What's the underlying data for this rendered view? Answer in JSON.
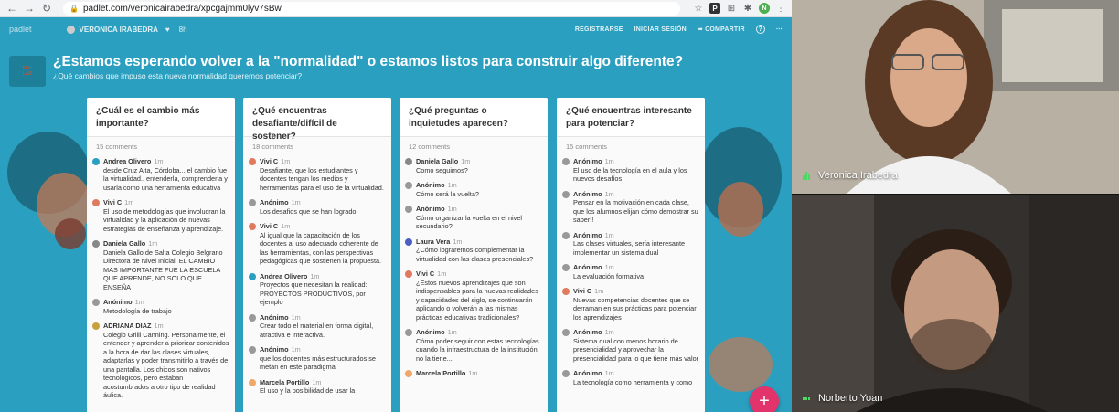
{
  "browser": {
    "url": "padlet.com/veronicairabedra/xpcgajmm0lyv7sBw",
    "avatar_initial": "N"
  },
  "padlet": {
    "brand": "padlet",
    "author": "VERONICA IRABEDRA",
    "time": "8h",
    "actions": {
      "register": "REGISTRARSE",
      "login": "INICIAR SESIÓN",
      "share": "COMPARTIR"
    },
    "title": "¿Estamos esperando volver a la \"normalidad\" o estamos listos para construir algo diferente?",
    "subtitle": "¿Qué cambios que impuso esta nueva normalidad queremos potenciar?",
    "accent": "#2b9fbf",
    "columns": [
      {
        "title": "¿Cuál es el cambio más importante?",
        "count": "15 comments",
        "posts": [
          {
            "who": "Andrea Olivero",
            "when": "1m",
            "text": "desde Cruz Alta, Córdoba... el cambio fue la virtualidad.. entenderla, comprenderla y usarla como una herramienta educativa",
            "color": "#2b9fbf"
          },
          {
            "who": "Vivi C",
            "when": "1m",
            "text": "El uso de metodologías que involucran la virtualidad y la aplicación de nuevas estrategias de enseñanza y aprendizaje.",
            "color": "#e07a5f"
          },
          {
            "who": "Daniela Gallo",
            "when": "1m",
            "text": "Daniela Gallo de Salta Colegio Belgrano Directora de Nivel Inicial. EL CAMBIO MAS IMPORTANTE FUE LA ESCUELA QUE APRENDE, NO SOLO QUE ENSEÑA",
            "color": "#888"
          },
          {
            "who": "Anónimo",
            "when": "1m",
            "text": "Metodología de trabajo",
            "color": "#999"
          },
          {
            "who": "ADRIANA DIAZ",
            "when": "1m",
            "text": "Colegio Grilli Canning. Personalmente, el entender y aprender a priorizar contenidos a la hora de dar las clases virtuales, adaptarlas y poder transmitirlo a través de una pantalla. Los chicos son nativos tecnológicos, pero estaban acostumbrados a otro tipo de realidad áulica.",
            "color": "#c8a03c"
          }
        ]
      },
      {
        "title": "¿Qué encuentras desafiante/difícil de sostener?",
        "count": "18 comments",
        "posts": [
          {
            "who": "Vivi C",
            "when": "1m",
            "text": "Desafiante, que los estudiantes y docentes tengan los medios y herramientas para el uso de la virtualidad.",
            "color": "#e07a5f"
          },
          {
            "who": "Anónimo",
            "when": "1m",
            "text": "Los desafios que se han logrado",
            "color": "#999"
          },
          {
            "who": "Vivi C",
            "when": "1m",
            "text": "Al igual que la capacitación de los docentes al uso adecuado coherente de las herramientas, con las perspectivas pedagógicas que sostienen la propuesta.",
            "color": "#e07a5f"
          },
          {
            "who": "Andrea Olivero",
            "when": "1m",
            "text": "Proyectos que necesitan la realidad: PROYECTOS PRODUCTIVOS, por ejemplo",
            "color": "#2b9fbf"
          },
          {
            "who": "Anónimo",
            "when": "1m",
            "text": "Crear todo el material en forma digital, atractiva e interactiva.",
            "color": "#999"
          },
          {
            "who": "Anónimo",
            "when": "1m",
            "text": "que los docentes más estructurados se metan en este paradigma",
            "color": "#999"
          },
          {
            "who": "Marcela Portillo",
            "when": "1m",
            "text": "El uso y la posibilidad de usar la",
            "color": "#f0a868"
          }
        ]
      },
      {
        "title": "¿Qué preguntas o inquietudes aparecen?",
        "count": "12 comments",
        "posts": [
          {
            "who": "Daniela Gallo",
            "when": "1m",
            "text": "Como seguimos?",
            "color": "#888"
          },
          {
            "who": "Anónimo",
            "when": "1m",
            "text": "Cómo será la vuelta?",
            "color": "#999"
          },
          {
            "who": "Anónimo",
            "when": "1m",
            "text": "Cómo organizar la vuelta en el nivel secundario?",
            "color": "#999"
          },
          {
            "who": "Laura Vera",
            "when": "1m",
            "text": "¿Cómo lograremos complementar la virtualidad con las clases presenciales?",
            "color": "#4a5fc1"
          },
          {
            "who": "Vivi C",
            "when": "1m",
            "text": "¿Estos nuevos aprendizajes que son indispensables para la nuevas realidades y capacidades del siglo, se continuarán aplicando o volverán a las mismas prácticas educativas tradicionales?",
            "color": "#e07a5f"
          },
          {
            "who": "Anónimo",
            "when": "1m",
            "text": "Cómo poder seguir con estas tecnologías cuando la infraestructura de la institución no la tiene...",
            "color": "#999"
          },
          {
            "who": "Marcela Portillo",
            "when": "1m",
            "text": "",
            "color": "#f0a868"
          }
        ]
      },
      {
        "title": "¿Qué encuentras interesante para potenciar?",
        "count": "15 comments",
        "posts": [
          {
            "who": "Anónimo",
            "when": "1m",
            "text": "El uso de la tecnología en el aula y los nuevos desafíos",
            "color": "#999"
          },
          {
            "who": "Anónimo",
            "when": "1m",
            "text": "Pensar en la motivación en cada clase, que los alumnos elijan cómo demostrar su saber!!",
            "color": "#999"
          },
          {
            "who": "Anónimo",
            "when": "1m",
            "text": "Las clases virtuales, sería interesante implementar un sistema dual",
            "color": "#999"
          },
          {
            "who": "Anónimo",
            "when": "1m",
            "text": "La evaluación formativa",
            "color": "#999"
          },
          {
            "who": "Vivi C",
            "when": "1m",
            "text": "Nuevas competencias docentes que se derraman en sus prácticas para potenciar los aprendizajes",
            "color": "#e07a5f"
          },
          {
            "who": "Anónimo",
            "when": "1m",
            "text": "Sistema dual con menos horario de presencialidad y aprovechar la presencialidad para lo que tiene más valor",
            "color": "#999"
          },
          {
            "who": "Anónimo",
            "when": "1m",
            "text": "La tecnología como herramienta y como",
            "color": "#999"
          }
        ]
      }
    ]
  },
  "video": {
    "participant_1": "Veronica Irabedra",
    "participant_2": "Norberto Yoan"
  }
}
